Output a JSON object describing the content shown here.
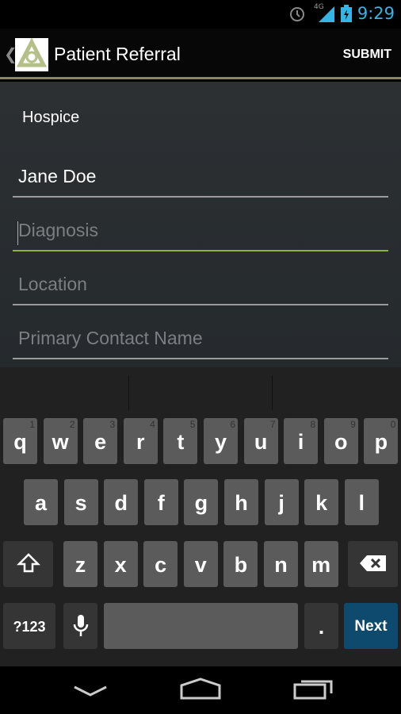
{
  "status": {
    "time": "9:29",
    "network": "4G",
    "icons": [
      "alarm-icon",
      "signal-icon",
      "battery-charging-icon"
    ],
    "accent": "#33b5e5"
  },
  "actionbar": {
    "title": "Patient Referral",
    "submit": "SUBMIT"
  },
  "form": {
    "section": "Hospice",
    "fields": [
      {
        "value": "Jane Doe",
        "placeholder": ""
      },
      {
        "value": "",
        "placeholder": "Diagnosis",
        "focused": true
      },
      {
        "value": "",
        "placeholder": "Location"
      },
      {
        "value": "",
        "placeholder": "Primary Contact Name"
      }
    ],
    "focus_color": "#8bb33a"
  },
  "keyboard": {
    "row1": [
      [
        "q",
        "1"
      ],
      [
        "w",
        "2"
      ],
      [
        "e",
        "3"
      ],
      [
        "r",
        "4"
      ],
      [
        "t",
        "5"
      ],
      [
        "y",
        "6"
      ],
      [
        "u",
        "7"
      ],
      [
        "i",
        "8"
      ],
      [
        "o",
        "9"
      ],
      [
        "p",
        "0"
      ]
    ],
    "row2": [
      "a",
      "s",
      "d",
      "f",
      "g",
      "h",
      "j",
      "k",
      "l"
    ],
    "row3": [
      "z",
      "x",
      "c",
      "v",
      "b",
      "n",
      "m"
    ],
    "symbols": "?123",
    "period": ".",
    "next": "Next",
    "next_color": "#0e4a6e"
  },
  "nav": [
    "back-icon",
    "home-icon",
    "recents-icon"
  ]
}
